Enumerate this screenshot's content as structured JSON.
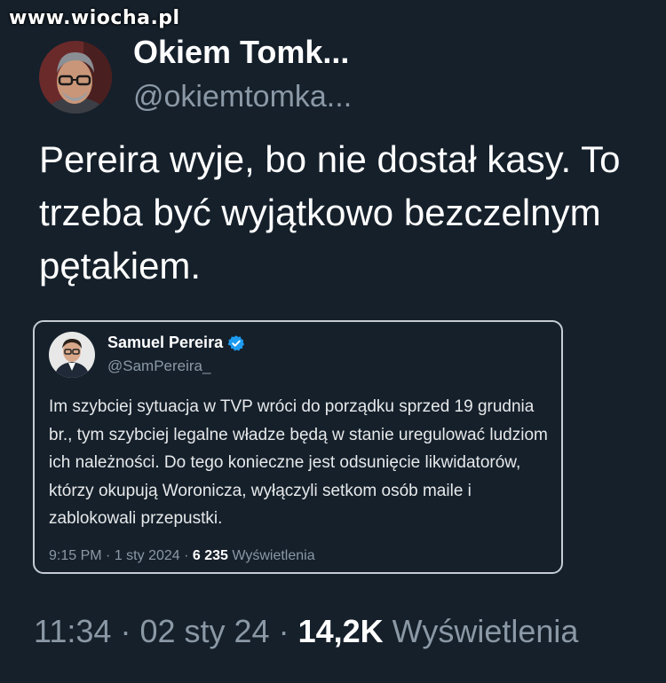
{
  "watermark": "www.wiocha.pl",
  "tweet": {
    "display_name": "Okiem Tomk...",
    "handle": "@okiemtomka...",
    "text": "Pereira wyje, bo nie dostał kasy. To trzeba być wyjątkowo bezczelnym pętakiem.",
    "time": "11:34",
    "date": "02 sty 24",
    "views_count": "14,2K",
    "views_label": "Wyświetlenia",
    "separator": "·"
  },
  "quoted": {
    "display_name": "Samuel Pereira",
    "handle": "@SamPereira_",
    "verified_icon": "verified-badge-icon",
    "verified_color": "#1d9bf0",
    "text": "Im szybciej sytuacja w TVP wróci do porządku sprzed 19 grudnia br., tym szybciej legalne władze będą w stanie uregulować ludziom ich należności. Do tego konieczne jest odsunięcie likwidatorów, którzy okupują Woronicza, wyłączyli setkom osób maile i zablokowali przepustki.",
    "time": "9:15 PM",
    "date": "1 sty 2024",
    "views_count": "6 235",
    "views_label": "Wyświetlenia",
    "separator": "·"
  },
  "colors": {
    "background": "#15202b",
    "text_primary": "#ffffff",
    "text_secondary": "#8b98a5",
    "quote_border": "#c5ccd3"
  }
}
